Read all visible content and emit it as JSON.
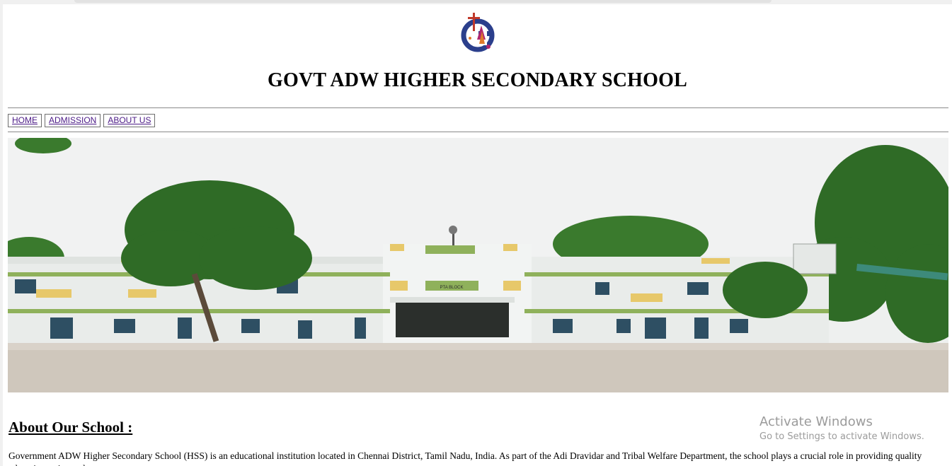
{
  "school": {
    "title": "GOVT ADW HIGHER SECONDARY SCHOOL",
    "logo_icon": "school-crest-logo"
  },
  "nav": {
    "items": [
      {
        "label": "HOME"
      },
      {
        "label": "ADMISSION"
      },
      {
        "label": "ABOUT US"
      }
    ],
    "link_color": "#4b1a86"
  },
  "hero": {
    "sign_text": "PTA BLOCK"
  },
  "about": {
    "heading": "About Our School :",
    "paragraph": "Government ADW Higher Secondary School (HSS) is an educational institution located in Chennai District, Tamil Nadu, India. As part of the Adi Dravidar and Tribal Welfare Department, the school plays a crucial role in providing quality education to its students."
  },
  "watermark": {
    "title": "Activate Windows",
    "subtitle": "Go to Settings to activate Windows."
  }
}
